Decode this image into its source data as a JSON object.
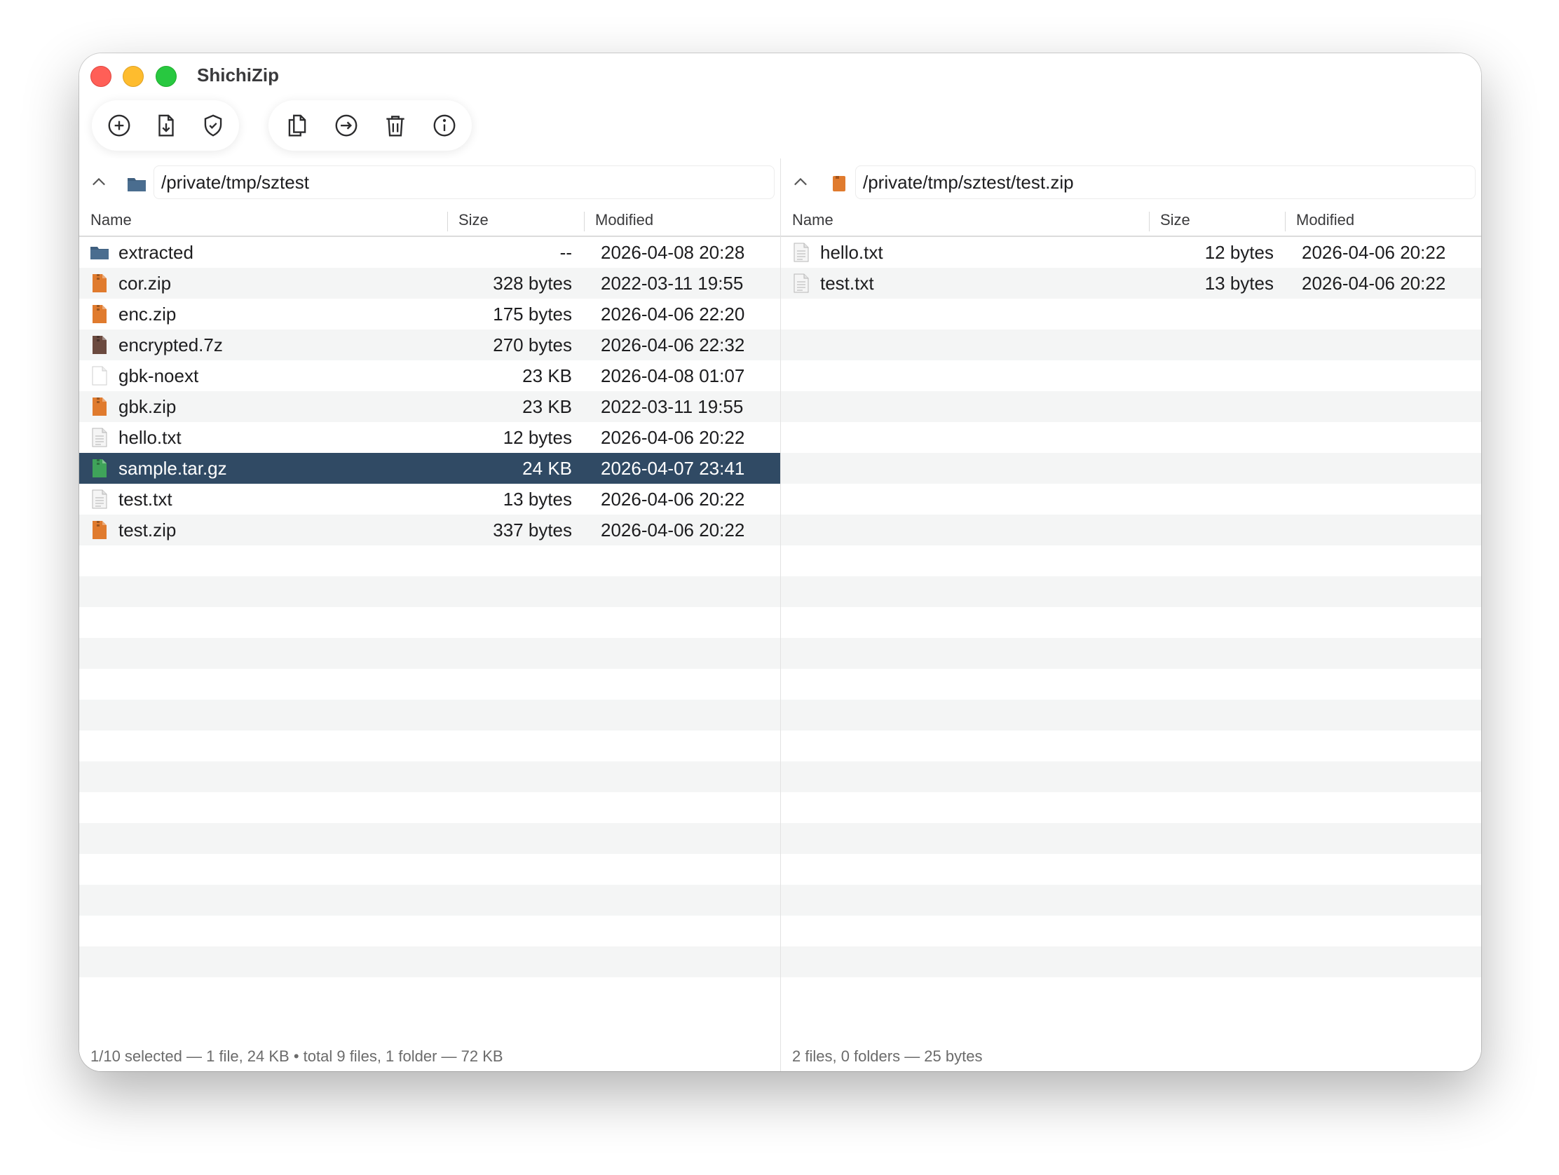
{
  "app": {
    "title": "ShichiZip"
  },
  "toolbar": {
    "group1": [
      {
        "name": "add-button",
        "icon": "plus-circle-icon"
      },
      {
        "name": "extract-button",
        "icon": "extract-document-icon"
      },
      {
        "name": "test-button",
        "icon": "shield-check-icon"
      }
    ],
    "group2": [
      {
        "name": "copy-button",
        "icon": "copy-documents-icon"
      },
      {
        "name": "move-button",
        "icon": "arrow-right-circle-icon"
      },
      {
        "name": "delete-button",
        "icon": "trash-icon"
      },
      {
        "name": "info-button",
        "icon": "info-circle-icon"
      }
    ]
  },
  "left_pane": {
    "path": "/private/tmp/sztest",
    "path_icon": "folder-icon",
    "columns": {
      "name": "Name",
      "size": "Size",
      "modified": "Modified"
    },
    "rows": [
      {
        "name": "extracted",
        "size": "--",
        "modified": "2026-04-08 20:28",
        "type": "folder"
      },
      {
        "name": "cor.zip",
        "size": "328 bytes",
        "modified": "2022-03-11 19:55",
        "type": "zip"
      },
      {
        "name": "enc.zip",
        "size": "175 bytes",
        "modified": "2026-04-06 22:20",
        "type": "zip"
      },
      {
        "name": "encrypted.7z",
        "size": "270 bytes",
        "modified": "2026-04-06 22:32",
        "type": "7z"
      },
      {
        "name": "gbk-noext",
        "size": "23 KB",
        "modified": "2026-04-08 01:07",
        "type": "blank"
      },
      {
        "name": "gbk.zip",
        "size": "23 KB",
        "modified": "2022-03-11 19:55",
        "type": "zip"
      },
      {
        "name": "hello.txt",
        "size": "12 bytes",
        "modified": "2026-04-06 20:22",
        "type": "text"
      },
      {
        "name": "sample.tar.gz",
        "size": "24 KB",
        "modified": "2026-04-07 23:41",
        "type": "targz",
        "selected": true
      },
      {
        "name": "test.txt",
        "size": "13 bytes",
        "modified": "2026-04-06 20:22",
        "type": "text"
      },
      {
        "name": "test.zip",
        "size": "337 bytes",
        "modified": "2026-04-06 20:22",
        "type": "zip"
      }
    ],
    "status": "1/10 selected — 1 file, 24 KB  •  total 9 files, 1 folder — 72 KB"
  },
  "right_pane": {
    "path": "/private/tmp/sztest/test.zip",
    "path_icon": "zip-archive-icon",
    "columns": {
      "name": "Name",
      "size": "Size",
      "modified": "Modified"
    },
    "rows": [
      {
        "name": "hello.txt",
        "size": "12 bytes",
        "modified": "2026-04-06 20:22",
        "type": "text"
      },
      {
        "name": "test.txt",
        "size": "13 bytes",
        "modified": "2026-04-06 20:22",
        "type": "text"
      }
    ],
    "status": "2 files, 0 folders — 25 bytes"
  },
  "colors": {
    "selection": "#304a64",
    "zip_icon": "#e07b2e",
    "folder_icon": "#3f5f7f",
    "sevenz_icon": "#6b4a3f",
    "targz_icon": "#3fa35a"
  }
}
